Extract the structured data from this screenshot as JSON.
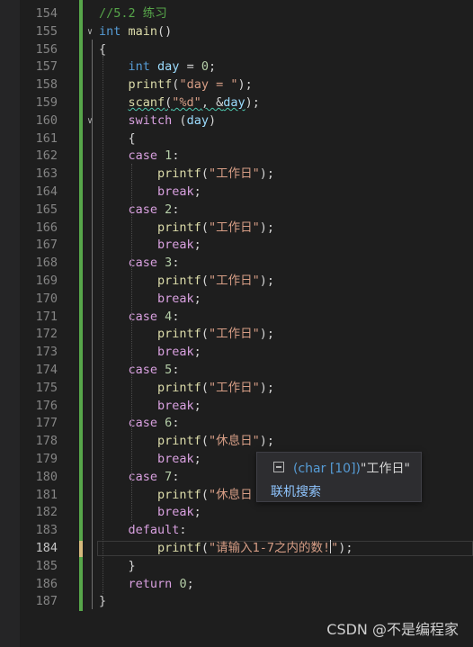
{
  "editor": {
    "lines": [
      {
        "n": "154",
        "segs": [
          {
            "t": "//5.2 练习",
            "c": "cmt"
          }
        ]
      },
      {
        "n": "155",
        "segs": [
          {
            "t": "int",
            "c": "kw"
          },
          {
            "t": " "
          },
          {
            "t": "main",
            "c": "fn"
          },
          {
            "t": "()"
          }
        ]
      },
      {
        "n": "156",
        "segs": [
          {
            "t": "{"
          }
        ]
      },
      {
        "n": "157",
        "segs": [
          {
            "t": "    "
          },
          {
            "t": "int",
            "c": "kw"
          },
          {
            "t": " "
          },
          {
            "t": "day",
            "c": "var"
          },
          {
            "t": " = "
          },
          {
            "t": "0",
            "c": "num"
          },
          {
            "t": ";"
          }
        ]
      },
      {
        "n": "158",
        "segs": [
          {
            "t": "    "
          },
          {
            "t": "printf",
            "c": "fn"
          },
          {
            "t": "("
          },
          {
            "t": "\"day = \"",
            "c": "str"
          },
          {
            "t": ");"
          }
        ]
      },
      {
        "n": "159",
        "segs": [
          {
            "t": "    "
          },
          {
            "t": "scanf",
            "c": "fn squig"
          },
          {
            "t": "(",
            "c": "squig"
          },
          {
            "t": "\"%d\"",
            "c": "str squig"
          },
          {
            "t": ", &",
            "c": "squig"
          },
          {
            "t": "day",
            "c": "var squig"
          },
          {
            "t": ");"
          }
        ]
      },
      {
        "n": "160",
        "segs": [
          {
            "t": "    "
          },
          {
            "t": "switch",
            "c": "ctl"
          },
          {
            "t": " ("
          },
          {
            "t": "day",
            "c": "var"
          },
          {
            "t": ")"
          }
        ]
      },
      {
        "n": "161",
        "segs": [
          {
            "t": "    {"
          }
        ]
      },
      {
        "n": "162",
        "segs": [
          {
            "t": "    "
          },
          {
            "t": "case",
            "c": "ctl"
          },
          {
            "t": " "
          },
          {
            "t": "1",
            "c": "num"
          },
          {
            "t": ":"
          }
        ]
      },
      {
        "n": "163",
        "segs": [
          {
            "t": "        "
          },
          {
            "t": "printf",
            "c": "fn"
          },
          {
            "t": "("
          },
          {
            "t": "\"工作日\"",
            "c": "str"
          },
          {
            "t": ");"
          }
        ]
      },
      {
        "n": "164",
        "segs": [
          {
            "t": "        "
          },
          {
            "t": "break",
            "c": "ctl"
          },
          {
            "t": ";"
          }
        ]
      },
      {
        "n": "165",
        "segs": [
          {
            "t": "    "
          },
          {
            "t": "case",
            "c": "ctl"
          },
          {
            "t": " "
          },
          {
            "t": "2",
            "c": "num"
          },
          {
            "t": ":"
          }
        ]
      },
      {
        "n": "166",
        "segs": [
          {
            "t": "        "
          },
          {
            "t": "printf",
            "c": "fn"
          },
          {
            "t": "("
          },
          {
            "t": "\"工作日\"",
            "c": "str"
          },
          {
            "t": ");"
          }
        ]
      },
      {
        "n": "167",
        "segs": [
          {
            "t": "        "
          },
          {
            "t": "break",
            "c": "ctl"
          },
          {
            "t": ";"
          }
        ]
      },
      {
        "n": "168",
        "segs": [
          {
            "t": "    "
          },
          {
            "t": "case",
            "c": "ctl"
          },
          {
            "t": " "
          },
          {
            "t": "3",
            "c": "num"
          },
          {
            "t": ":"
          }
        ]
      },
      {
        "n": "169",
        "segs": [
          {
            "t": "        "
          },
          {
            "t": "printf",
            "c": "fn"
          },
          {
            "t": "("
          },
          {
            "t": "\"工作日\"",
            "c": "str"
          },
          {
            "t": ");"
          }
        ]
      },
      {
        "n": "170",
        "segs": [
          {
            "t": "        "
          },
          {
            "t": "break",
            "c": "ctl"
          },
          {
            "t": ";"
          }
        ]
      },
      {
        "n": "171",
        "segs": [
          {
            "t": "    "
          },
          {
            "t": "case",
            "c": "ctl"
          },
          {
            "t": " "
          },
          {
            "t": "4",
            "c": "num"
          },
          {
            "t": ":"
          }
        ]
      },
      {
        "n": "172",
        "segs": [
          {
            "t": "        "
          },
          {
            "t": "printf",
            "c": "fn"
          },
          {
            "t": "("
          },
          {
            "t": "\"工作日\"",
            "c": "str"
          },
          {
            "t": ");"
          }
        ]
      },
      {
        "n": "173",
        "segs": [
          {
            "t": "        "
          },
          {
            "t": "break",
            "c": "ctl"
          },
          {
            "t": ";"
          }
        ]
      },
      {
        "n": "174",
        "segs": [
          {
            "t": "    "
          },
          {
            "t": "case",
            "c": "ctl"
          },
          {
            "t": " "
          },
          {
            "t": "5",
            "c": "num"
          },
          {
            "t": ":"
          }
        ]
      },
      {
        "n": "175",
        "segs": [
          {
            "t": "        "
          },
          {
            "t": "printf",
            "c": "fn"
          },
          {
            "t": "("
          },
          {
            "t": "\"工作日\"",
            "c": "str"
          },
          {
            "t": ");"
          }
        ]
      },
      {
        "n": "176",
        "segs": [
          {
            "t": "        "
          },
          {
            "t": "break",
            "c": "ctl"
          },
          {
            "t": ";"
          }
        ]
      },
      {
        "n": "177",
        "segs": [
          {
            "t": "    "
          },
          {
            "t": "case",
            "c": "ctl"
          },
          {
            "t": " "
          },
          {
            "t": "6",
            "c": "num"
          },
          {
            "t": ":"
          }
        ]
      },
      {
        "n": "178",
        "segs": [
          {
            "t": "        "
          },
          {
            "t": "printf",
            "c": "fn"
          },
          {
            "t": "("
          },
          {
            "t": "\"休息日\"",
            "c": "str"
          },
          {
            "t": ");"
          }
        ]
      },
      {
        "n": "179",
        "segs": [
          {
            "t": "        "
          },
          {
            "t": "break",
            "c": "ctl"
          },
          {
            "t": ";"
          }
        ]
      },
      {
        "n": "180",
        "segs": [
          {
            "t": "    "
          },
          {
            "t": "case",
            "c": "ctl"
          },
          {
            "t": " "
          },
          {
            "t": "7",
            "c": "num"
          },
          {
            "t": ":"
          }
        ]
      },
      {
        "n": "181",
        "segs": [
          {
            "t": "        "
          },
          {
            "t": "printf",
            "c": "fn"
          },
          {
            "t": "("
          },
          {
            "t": "\"休息日",
            "c": "str"
          }
        ]
      },
      {
        "n": "182",
        "segs": [
          {
            "t": "        "
          },
          {
            "t": "break",
            "c": "ctl"
          },
          {
            "t": ";"
          }
        ]
      },
      {
        "n": "183",
        "segs": [
          {
            "t": "    "
          },
          {
            "t": "default",
            "c": "ctl"
          },
          {
            "t": ":"
          }
        ]
      },
      {
        "n": "184",
        "segs": [
          {
            "t": "        "
          },
          {
            "t": "printf",
            "c": "fn"
          },
          {
            "t": "("
          },
          {
            "t": "\"请输入1-7之内的数!",
            "c": "str"
          },
          {
            "t": "|",
            "c": "caret"
          },
          {
            "t": "\"",
            "c": "str"
          },
          {
            "t": ");"
          }
        ]
      },
      {
        "n": "185",
        "segs": [
          {
            "t": "    }"
          }
        ]
      },
      {
        "n": "186",
        "segs": [
          {
            "t": "    "
          },
          {
            "t": "return",
            "c": "ctl"
          },
          {
            "t": " "
          },
          {
            "t": "0",
            "c": "num"
          },
          {
            "t": ";"
          }
        ]
      },
      {
        "n": "187",
        "segs": [
          {
            "t": "}"
          }
        ]
      }
    ],
    "active_line": "184"
  },
  "tooltip": {
    "type_text": "(char [10])",
    "value_text": "\"工作日\"",
    "search_link": "联机搜索"
  },
  "watermark": "CSDN @不是编程家",
  "colors": {
    "background": "#1e1e1e",
    "keyword": "#569cd6",
    "control": "#d8a0df",
    "function": "#dcdcaa",
    "variable": "#9cdcfe",
    "string": "#d69d85",
    "number": "#b5cea8",
    "comment": "#57a64a"
  }
}
